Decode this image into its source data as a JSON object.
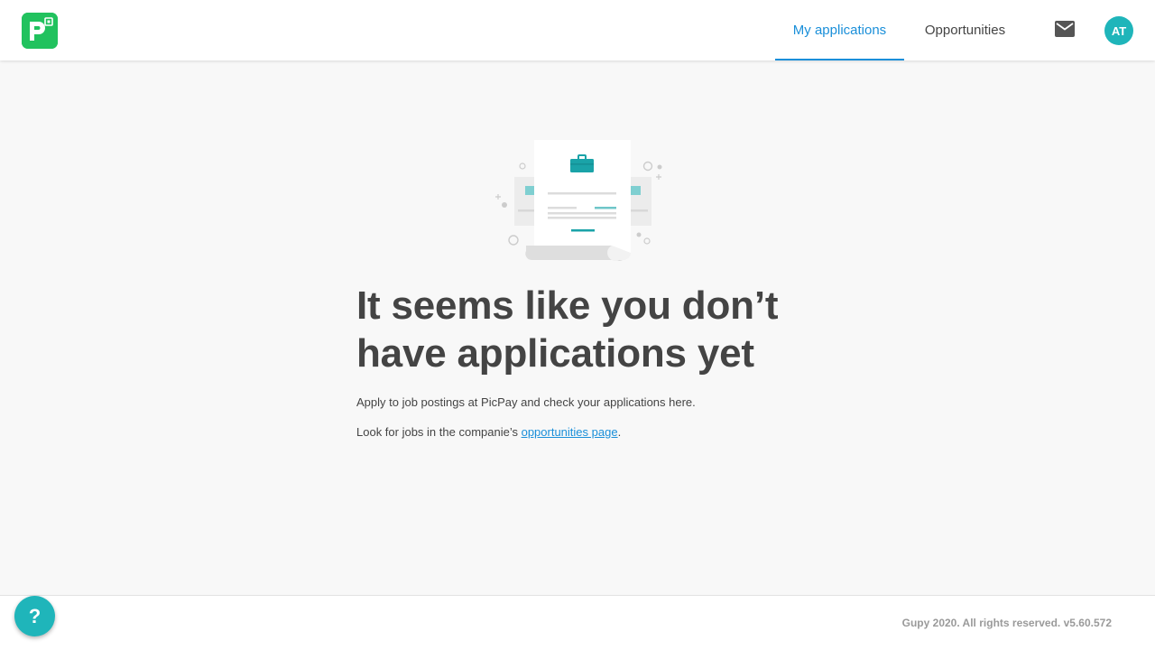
{
  "header": {
    "logo_icon": "picpay-logo",
    "nav": [
      {
        "label": "My applications",
        "active": true
      },
      {
        "label": "Opportunities",
        "active": false
      }
    ],
    "mail_icon": "mail-icon",
    "avatar_initials": "AT"
  },
  "empty_state": {
    "illustration_icon": "empty-applications-illustration",
    "title": "It seems like you don’t have applications yet",
    "line1": "Apply to job postings at PicPay and check your applications here.",
    "line2_prefix": "Look for jobs in the companie’s ",
    "line2_link": "opportunities page",
    "line2_suffix": "."
  },
  "footer": {
    "copyright": "Gupy 2020. All rights reserved. v5.60.572",
    "help_label": "?"
  },
  "colors": {
    "accent": "#1a8fd9",
    "brand_green": "#21c25e",
    "teal": "#1fb5ba",
    "text": "#444444",
    "background": "#f8f8f8"
  }
}
